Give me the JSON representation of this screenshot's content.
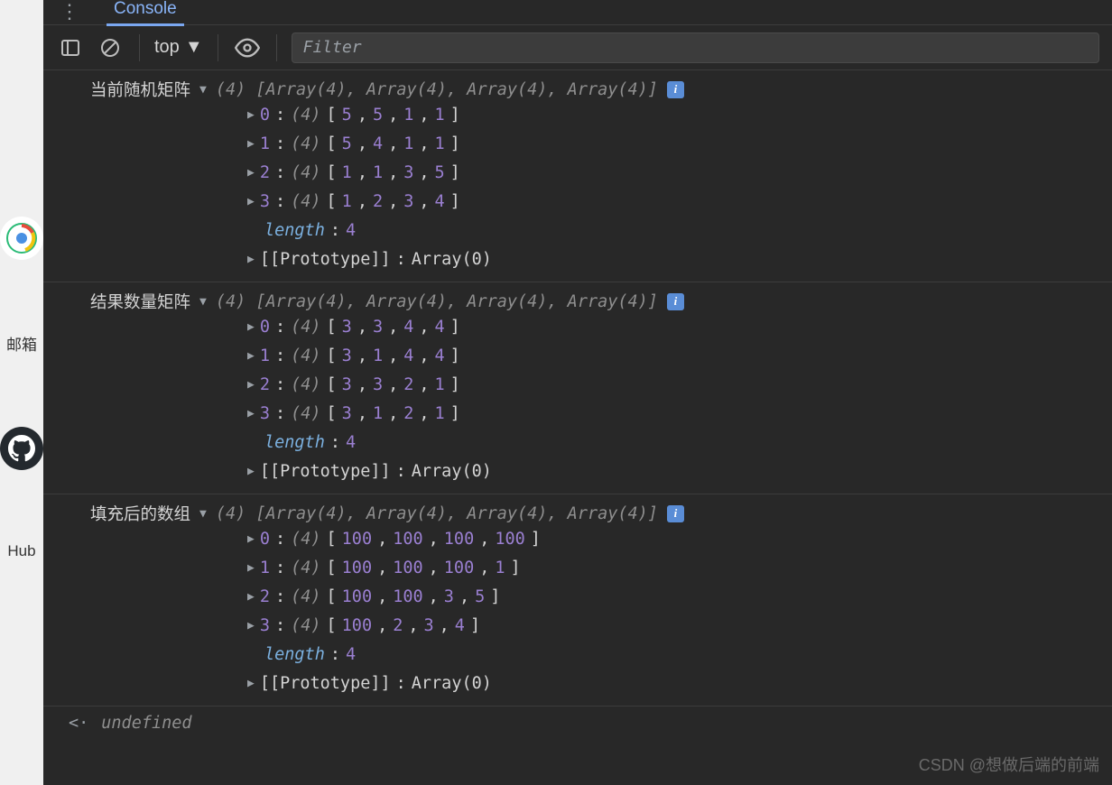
{
  "tabs": {
    "active": "Console",
    "kebab": "⋮"
  },
  "toolbar": {
    "scope": "top",
    "filter_placeholder": "Filter"
  },
  "groups": [
    {
      "label": "当前随机矩阵",
      "summary_count": "(4)",
      "summary_body": "[Array(4), Array(4), Array(4), Array(4)]",
      "rows": [
        {
          "idx": "0",
          "len": "(4)",
          "vals": [
            5,
            5,
            1,
            1
          ]
        },
        {
          "idx": "1",
          "len": "(4)",
          "vals": [
            5,
            4,
            1,
            1
          ]
        },
        {
          "idx": "2",
          "len": "(4)",
          "vals": [
            1,
            1,
            3,
            5
          ]
        },
        {
          "idx": "3",
          "len": "(4)",
          "vals": [
            1,
            2,
            3,
            4
          ]
        }
      ],
      "length_label": "length",
      "length_value": "4",
      "proto_label": "[[Prototype]]",
      "proto_value": "Array(0)"
    },
    {
      "label": "结果数量矩阵",
      "summary_count": "(4)",
      "summary_body": "[Array(4), Array(4), Array(4), Array(4)]",
      "rows": [
        {
          "idx": "0",
          "len": "(4)",
          "vals": [
            3,
            3,
            4,
            4
          ]
        },
        {
          "idx": "1",
          "len": "(4)",
          "vals": [
            3,
            1,
            4,
            4
          ]
        },
        {
          "idx": "2",
          "len": "(4)",
          "vals": [
            3,
            3,
            2,
            1
          ]
        },
        {
          "idx": "3",
          "len": "(4)",
          "vals": [
            3,
            1,
            2,
            1
          ]
        }
      ],
      "length_label": "length",
      "length_value": "4",
      "proto_label": "[[Prototype]]",
      "proto_value": "Array(0)"
    },
    {
      "label": "填充后的数组",
      "summary_count": "(4)",
      "summary_body": "[Array(4), Array(4), Array(4), Array(4)]",
      "rows": [
        {
          "idx": "0",
          "len": "(4)",
          "vals": [
            100,
            100,
            100,
            100
          ]
        },
        {
          "idx": "1",
          "len": "(4)",
          "vals": [
            100,
            100,
            100,
            1
          ]
        },
        {
          "idx": "2",
          "len": "(4)",
          "vals": [
            100,
            100,
            3,
            5
          ]
        },
        {
          "idx": "3",
          "len": "(4)",
          "vals": [
            100,
            2,
            3,
            4
          ]
        }
      ],
      "length_label": "length",
      "length_value": "4",
      "proto_label": "[[Prototype]]",
      "proto_value": "Array(0)"
    }
  ],
  "return_value": "undefined",
  "left_rail": {
    "mail": "邮箱",
    "hub": "Hub"
  },
  "watermark": "CSDN @想做后端的前端"
}
